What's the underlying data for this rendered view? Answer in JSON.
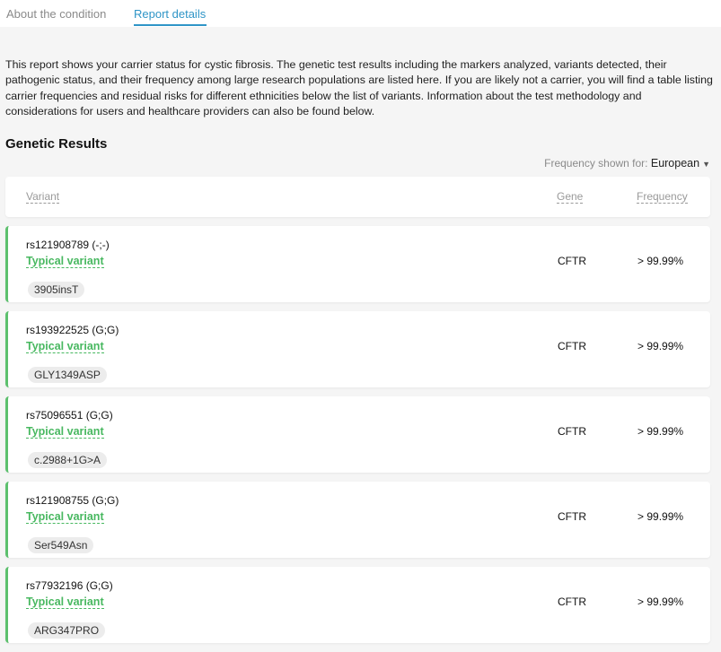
{
  "tabs": [
    {
      "label": "About the condition",
      "active": false
    },
    {
      "label": "Report details",
      "active": true
    }
  ],
  "intro": "This report shows your carrier status for cystic fibrosis. The genetic test results including the markers analyzed, variants detected, their pathogenic status, and their frequency among large research populations are listed here. If you are likely not a carrier, you will find a table listing carrier frequencies and residual risks for different ethnicities below the list of variants. Information about the test methodology and considerations for users and healthcare providers can also be found below.",
  "section_title": "Genetic Results",
  "frequency_selector": {
    "label": "Frequency shown for:",
    "value": "European"
  },
  "table_headers": {
    "variant": "Variant",
    "gene": "Gene",
    "frequency": "Frequency"
  },
  "variants": [
    {
      "rsid": "rs121908789 (-;-)",
      "status": "Typical variant",
      "name": "3905insT",
      "gene": "CFTR",
      "frequency": "> 99.99%"
    },
    {
      "rsid": "rs193922525 (G;G)",
      "status": "Typical variant",
      "name": "GLY1349ASP",
      "gene": "CFTR",
      "frequency": "> 99.99%"
    },
    {
      "rsid": "rs75096551 (G;G)",
      "status": "Typical variant",
      "name": "c.2988+1G>A",
      "gene": "CFTR",
      "frequency": "> 99.99%"
    },
    {
      "rsid": "rs121908755 (G;G)",
      "status": "Typical variant",
      "name": "Ser549Asn",
      "gene": "CFTR",
      "frequency": "> 99.99%"
    },
    {
      "rsid": "rs77932196 (G;G)",
      "status": "Typical variant",
      "name": "ARG347PRO",
      "gene": "CFTR",
      "frequency": "> 99.99%"
    }
  ],
  "colors": {
    "accent_tab": "#2f95c7",
    "typical_variant": "#48b860",
    "card_border": "#5cc06d"
  }
}
